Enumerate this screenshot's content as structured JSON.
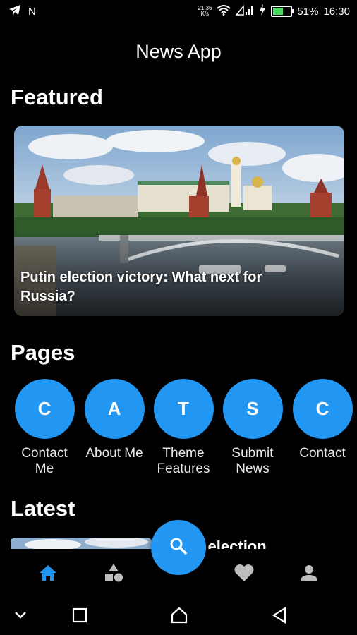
{
  "status_bar": {
    "left_icons": [
      "telegram-icon",
      "n-icon"
    ],
    "n_glyph": "N",
    "net_speed_value": "21.36",
    "net_speed_unit": "K/s",
    "battery_percent": "51%",
    "battery_level": 0.51,
    "time": "16:30"
  },
  "app_bar": {
    "title": "News App"
  },
  "featured": {
    "section_title": "Featured",
    "headline": "Putin election victory: What next for Russia?"
  },
  "pages": {
    "section_title": "Pages",
    "items": [
      {
        "letter": "C",
        "label": "Contact Me"
      },
      {
        "letter": "A",
        "label": "About Me"
      },
      {
        "letter": "T",
        "label": "Theme Features"
      },
      {
        "letter": "S",
        "label": "Submit News"
      },
      {
        "letter": "C",
        "label": "Contact"
      }
    ]
  },
  "latest": {
    "section_title": "Latest",
    "peek_text": "n election"
  },
  "bottom_nav": {
    "items": [
      "home-icon",
      "categories-icon",
      "favorites-icon",
      "profile-icon"
    ],
    "fab_icon": "search-icon",
    "active": "home-icon"
  },
  "colors": {
    "accent": "#2196f3",
    "background": "#000000",
    "text": "#ffffff"
  }
}
